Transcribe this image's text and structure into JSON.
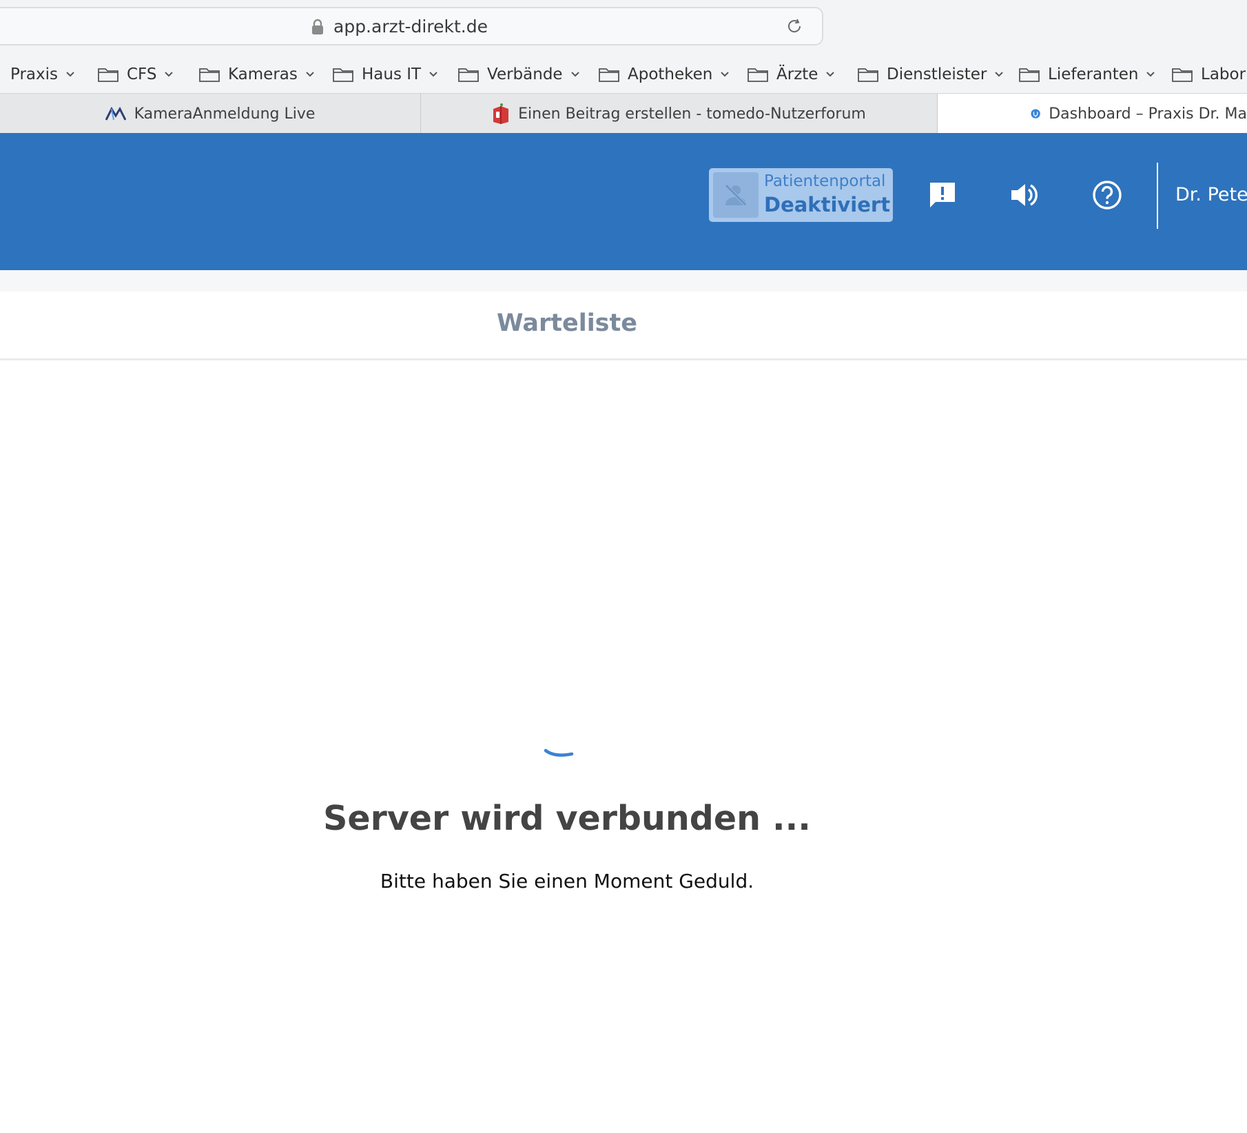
{
  "browser": {
    "url": "app.arzt-direkt.de",
    "bookmarks": [
      {
        "label": "Praxis"
      },
      {
        "label": "CFS"
      },
      {
        "label": "Kameras"
      },
      {
        "label": "Haus IT"
      },
      {
        "label": "Verbände"
      },
      {
        "label": "Apotheken"
      },
      {
        "label": "Ärzte"
      },
      {
        "label": "Dienstleister"
      },
      {
        "label": "Lieferanten"
      },
      {
        "label": "Labor"
      }
    ],
    "tabs": [
      {
        "title": "KameraAnmeldung Live",
        "icon": "kamera-logo-icon"
      },
      {
        "title": "Einen Beitrag erstellen - tomedo-Nutzerforum",
        "icon": "tomedo-forum-icon"
      },
      {
        "title": "Dashboard – Praxis Dr. Ma",
        "icon": "arzt-direkt-icon",
        "active": true
      }
    ]
  },
  "header": {
    "portal": {
      "title": "Patientenportal",
      "status": "Deaktiviert",
      "icon": "person-off-icon"
    },
    "icons": [
      "feedback-icon",
      "volume-icon",
      "help-icon"
    ],
    "user": "Dr. Pete"
  },
  "main": {
    "section_title": "Warteliste",
    "loading_title": "Server wird verbunden ...",
    "loading_subtitle": "Bitte haben Sie einen Moment Geduld."
  },
  "colors": {
    "header_bg": "#2e73bd",
    "badge_bg": "#a8c8ec",
    "spinner": "#3b82d6"
  }
}
